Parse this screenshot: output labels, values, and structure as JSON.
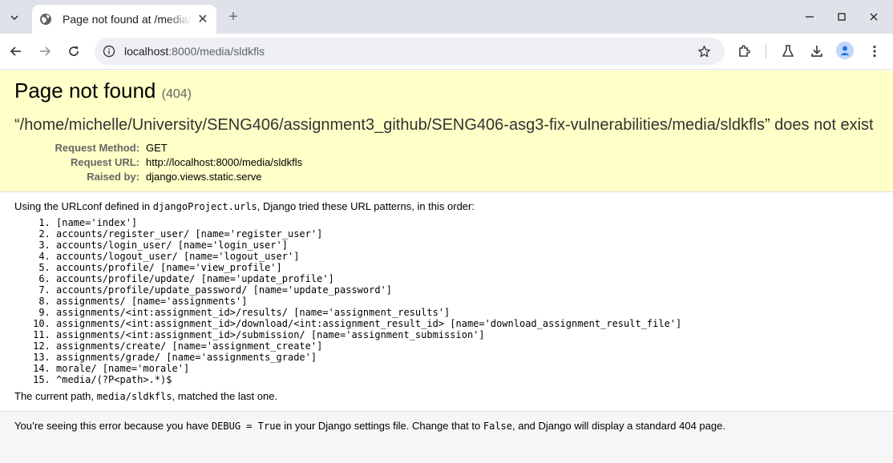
{
  "browser": {
    "tab_title": "Page not found at /media/sldkfls",
    "url_host": "localhost",
    "url_rest": ":8000/media/sldkfls"
  },
  "error": {
    "heading": "Page not found",
    "code": "(404)",
    "message": "“/home/michelle/University/SENG406/assignment3_github/SENG406-asg3-fix-vulnerabilities/media/sldkfls” does not exist",
    "meta": [
      {
        "label": "Request Method:",
        "value": "GET"
      },
      {
        "label": "Request URL:",
        "value": "http://localhost:8000/media/sldkfls"
      },
      {
        "label": "Raised by:",
        "value": "django.views.static.serve"
      }
    ]
  },
  "info": {
    "intro_pre": "Using the URLconf defined in ",
    "urlconf": "djangoProject.urls",
    "intro_post": ", Django tried these URL patterns, in this order:",
    "patterns": [
      "[name='index']",
      "accounts/register_user/ [name='register_user']",
      "accounts/login_user/ [name='login_user']",
      "accounts/logout_user/ [name='logout_user']",
      "accounts/profile/ [name='view_profile']",
      "accounts/profile/update/ [name='update_profile']",
      "accounts/profile/update_password/ [name='update_password']",
      "assignments/ [name='assignments']",
      "assignments/<int:assignment_id>/results/ [name='assignment_results']",
      "assignments/<int:assignment_id>/download/<int:assignment_result_id> [name='download_assignment_result_file']",
      "assignments/<int:assignment_id>/submission/ [name='assignment_submission']",
      "assignments/create/ [name='assignment_create']",
      "assignments/grade/ [name='assignments_grade']",
      "morale/ [name='morale']",
      "^media/(?P<path>.*)$"
    ],
    "current_pre": "The current path, ",
    "current_path": "media/sldkfls",
    "current_post": ", matched the last one."
  },
  "explanation": {
    "pre": "You’re seeing this error because you have ",
    "debug_code": "DEBUG = True",
    "mid": " in your Django settings file. Change that to ",
    "false_code": "False",
    "post": ", and Django will display a standard 404 page."
  },
  "icons": {
    "tab_menu": "chevron-down-icon",
    "favicon": "globe-icon",
    "back": "arrow-left-icon",
    "forward": "arrow-right-icon",
    "reload": "reload-icon",
    "site_info": "info-icon",
    "bookmark": "star-icon",
    "extensions": "puzzle-icon",
    "labs": "flask-icon",
    "downloads": "download-icon",
    "profile": "person-icon",
    "menu": "kebab-menu-icon"
  }
}
